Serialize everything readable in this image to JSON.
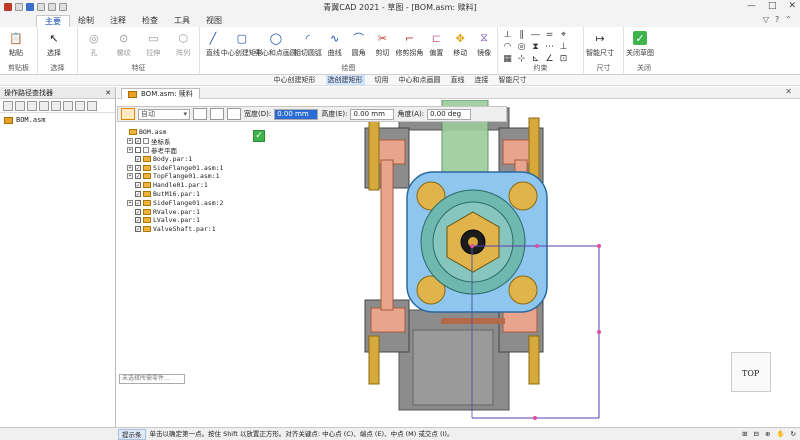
{
  "window": {
    "title": "青翼CAD 2021 - 草图 - [BOM.asm: 赎料]",
    "controls": [
      "—",
      "□",
      "✕"
    ]
  },
  "tabs": [
    "主要",
    "绘制",
    "注释",
    "检查",
    "工具",
    "视图"
  ],
  "tab_right": [
    "▽",
    "?",
    "⌃"
  ],
  "ribbon": {
    "clipboard": {
      "paste": "粘贴",
      "label": "剪贴板"
    },
    "select": {
      "select": "选择",
      "label": "选择"
    },
    "features": {
      "items": [
        "孔",
        "螺纹",
        "拉伸",
        "拉伸",
        "阵列"
      ],
      "label": "特征"
    },
    "draw": {
      "items": [
        "直线",
        "中心创建矩形",
        "中心和点画圆",
        "相切圆弧",
        "曲线",
        "圆角",
        "剪切",
        "修剪拐角",
        "偏置",
        "移动",
        "镜像"
      ],
      "label": "绘图"
    },
    "relate": {
      "label": "约束"
    },
    "dims": {
      "items": [
        "智能尺寸"
      ],
      "label": "尺寸"
    },
    "close": {
      "items": [
        "关闭草图"
      ],
      "label": "关闭"
    }
  },
  "snapbar": [
    "中心创建矩形",
    "选创建矩形",
    "切用",
    "中心和点画圆",
    "直线",
    "连接",
    "智能尺寸"
  ],
  "leftpane": {
    "title": "操作路径查找器",
    "pin": "✕",
    "root": "BOM.asm"
  },
  "doc_tab": {
    "label": "BOM.asm: 赎料",
    "close": "✕"
  },
  "cmdbar": {
    "dropdown": "自动",
    "width_label": "宽度(D):",
    "width_value": "0.00 mm",
    "height_label": "高度(E):",
    "height_value": "0.00 mm",
    "angle_label": "角度(A):",
    "angle_value": "0.00 deg"
  },
  "tree": [
    {
      "text": "BOM.asm",
      "indent": 0,
      "exp": "",
      "checked": false,
      "type": "asm"
    },
    {
      "text": "坐标系",
      "indent": 1,
      "exp": "+",
      "checked": true,
      "type": "coord"
    },
    {
      "text": "参考平面",
      "indent": 1,
      "exp": "+",
      "checked": false,
      "type": "plane"
    },
    {
      "text": "Body.par:1",
      "indent": 1,
      "exp": "",
      "checked": true,
      "type": "par"
    },
    {
      "text": "SideFlange01.asm:1",
      "indent": 1,
      "exp": "+",
      "checked": true,
      "type": "asm"
    },
    {
      "text": "TopFlange01.asm:1",
      "indent": 1,
      "exp": "+",
      "checked": true,
      "type": "asm"
    },
    {
      "text": "Handle01.par:1",
      "indent": 1,
      "exp": "",
      "checked": true,
      "type": "par"
    },
    {
      "text": "ButM16.par:1",
      "indent": 1,
      "exp": "",
      "checked": true,
      "type": "par"
    },
    {
      "text": "SideFlange01.asm:2",
      "indent": 1,
      "exp": "+",
      "checked": true,
      "type": "asm"
    },
    {
      "text": "RValve.par:1",
      "indent": 1,
      "exp": "",
      "checked": true,
      "type": "par"
    },
    {
      "text": "LValve.par:1",
      "indent": 1,
      "exp": "",
      "checked": true,
      "type": "par"
    },
    {
      "text": "ValveShaft.par:1",
      "indent": 1,
      "exp": "",
      "checked": true,
      "type": "par"
    }
  ],
  "hint_input": "未选择所需零件...",
  "viewcube": "TOP",
  "status": {
    "chip": "提示条",
    "text": "单击以确定第一点。按住 Shift 以放置正方形。对齐关键点: 中心点 (C)、端点 (E)、中点 (M) 或交点 (I)。",
    "right": [
      "⊞",
      "⊟",
      "⊕",
      "✋",
      "↻"
    ]
  },
  "colors": {
    "accent": "#1a4fb0",
    "body_gray": "#8c8c8c",
    "flange_salmon": "#e8a48c",
    "flange_blue": "#8ec6f0",
    "valve_teal": "#6fb8b0",
    "handle_green": "#9ccc9c",
    "bolt_gold": "#d6a93a",
    "sketch_purple": "#5a3fb0",
    "sketch_green": "#2db84a"
  }
}
